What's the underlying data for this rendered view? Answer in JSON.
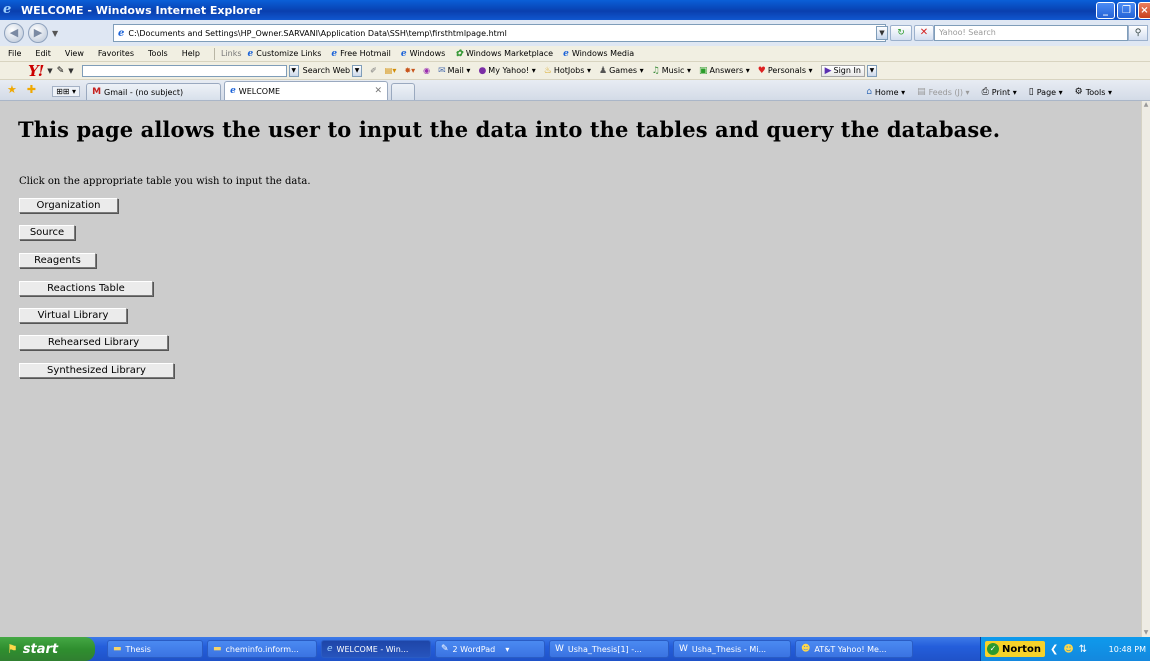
{
  "window": {
    "title": "WELCOME - Windows Internet Explorer"
  },
  "address": {
    "url": "C:\\Documents and Settings\\HP_Owner.SARVANI\\Application Data\\SSH\\temp\\firsthtmlpage.html",
    "search_placeholder": "Yahoo! Search"
  },
  "menu": {
    "items": [
      "File",
      "Edit",
      "View",
      "Favorites",
      "Tools",
      "Help"
    ],
    "links_label": "Links",
    "links": [
      "Customize Links",
      "Free Hotmail",
      "Windows",
      "Windows Marketplace",
      "Windows Media"
    ]
  },
  "yahoo_toolbar": {
    "logo": "Y!",
    "search_web_label": "Search Web",
    "items": [
      "Mail",
      "My Yahoo!",
      "HotJobs",
      "Games",
      "Music",
      "Answers",
      "Personals"
    ],
    "signin_label": "Sign In"
  },
  "tabs": {
    "items": [
      {
        "label": "Gmail - (no subject)",
        "active": false
      },
      {
        "label": "WELCOME",
        "active": true
      }
    ],
    "commands": [
      "Home",
      "Feeds (J)",
      "Print",
      "Page",
      "Tools"
    ]
  },
  "page": {
    "heading": "This page allows the user to input the data into the tables and query the database.",
    "instruction": "Click on the appropriate table you wish to input the data.",
    "buttons": [
      "Organization",
      "Source",
      "Reagents",
      "Reactions Table",
      "Virtual Library",
      "Rehearsed Library",
      "Synthesized Library"
    ]
  },
  "taskbar": {
    "start_label": "start",
    "items": [
      "Thesis",
      "cheminfo.inform...",
      "WELCOME - Win...",
      "2 WordPad",
      "Usha_Thesis[1] -...",
      "Usha_Thesis - Mi...",
      "AT&T Yahoo! Me..."
    ],
    "norton_label": "Norton",
    "clock": "10:48 PM"
  }
}
